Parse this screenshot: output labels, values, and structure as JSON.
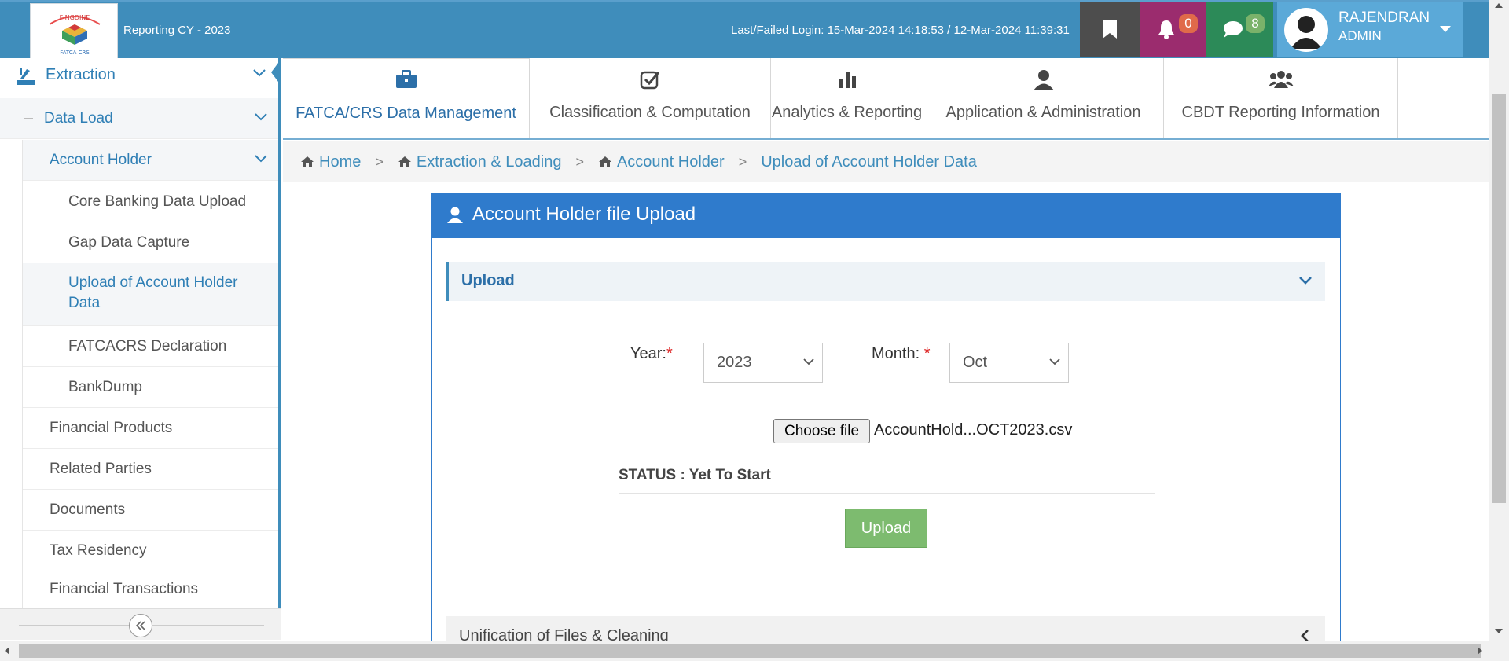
{
  "header": {
    "logo_text_top": "FINGDINE",
    "logo_text_bottom": "FATCA CRS",
    "reporting": "Reporting CY - 2023",
    "last_login": "Last/Failed Login: 15-Mar-2024 14:18:53 / 12-Mar-2024 11:39:31",
    "notifications_count": "0",
    "messages_count": "8",
    "user_name": "RAJENDRAN",
    "user_role": "ADMIN",
    "colors": {
      "header_bg": "#3f8dbb",
      "bell_bg": "#9b2c6e",
      "chat_bg": "#2c8a58",
      "bookmark_bg": "#4d4d4d"
    }
  },
  "sidebar": {
    "top_item": "Extraction",
    "items": [
      {
        "label": "Data Load",
        "level": 1
      },
      {
        "label": "Account Holder",
        "level": 2
      },
      {
        "label": "Core Banking Data Upload",
        "level": 3
      },
      {
        "label": "Gap Data Capture",
        "level": 3
      },
      {
        "label": "Upload of Account Holder Data",
        "level": 3,
        "active": true
      },
      {
        "label": "FATCACRS Declaration",
        "level": 3
      },
      {
        "label": "BankDump",
        "level": 3
      },
      {
        "label": "Financial Products",
        "level": 2
      },
      {
        "label": "Related Parties",
        "level": 2
      },
      {
        "label": "Documents",
        "level": 2
      },
      {
        "label": "Tax Residency",
        "level": 2
      },
      {
        "label": "Financial Transactions",
        "level": 2
      }
    ],
    "upload_line1": "Upload of Account Holder",
    "upload_line2": "Data"
  },
  "tabs": [
    {
      "label": "FATCA/CRS Data Management",
      "icon": "briefcase-icon",
      "active": true
    },
    {
      "label": "Classification & Computation",
      "icon": "check-square-icon"
    },
    {
      "label": "Analytics & Reporting",
      "icon": "bar-chart-icon"
    },
    {
      "label": "Application & Administration",
      "icon": "user-icon"
    },
    {
      "label": "CBDT Reporting Information",
      "icon": "users-icon"
    }
  ],
  "breadcrumb": [
    "Home",
    "Extraction & Loading",
    "Account Holder",
    "Upload of Account Holder Data"
  ],
  "panel": {
    "title": "Account Holder file Upload",
    "section_upload": "Upload",
    "year_label": "Year:",
    "year_value": "2023",
    "month_label": "Month: ",
    "month_value": "Oct",
    "required_mark": "*",
    "choose_file": "Choose file",
    "file_name": "AccountHold...OCT2023.csv",
    "status": "STATUS : Yet To Start",
    "upload_button": "Upload",
    "section_unification": "Unification of Files & Cleaning"
  }
}
